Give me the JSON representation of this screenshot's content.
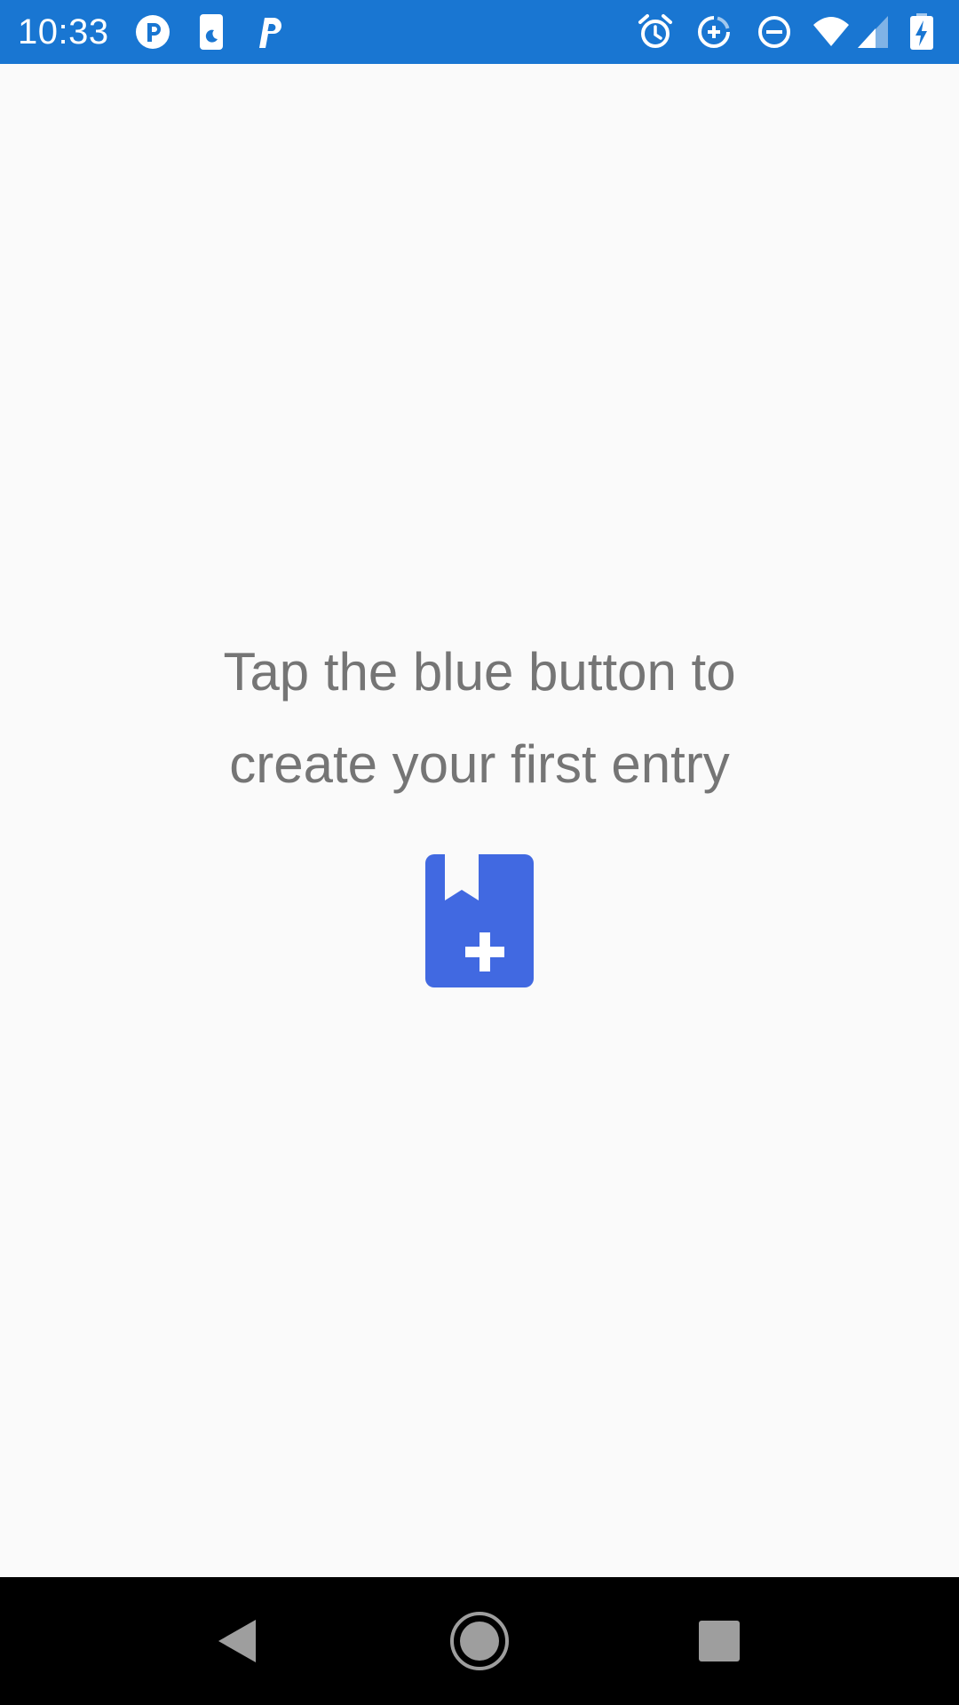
{
  "status_bar": {
    "time": "10:33",
    "background_color": "#1976d2",
    "left_icons": [
      "parking-icon",
      "night-mode-icon",
      "parking-p-icon"
    ],
    "right_icons": [
      "alarm-icon",
      "data-saver-icon",
      "do-not-disturb-icon",
      "wifi-icon",
      "cell-signal-icon",
      "battery-charging-icon"
    ]
  },
  "main": {
    "empty_message_line1": "Tap the blue button to",
    "empty_message_line2": "create your first entry",
    "text_color": "#757575",
    "icon": "bookmark-add-icon",
    "icon_color": "#4169e1"
  },
  "nav_bar": {
    "buttons": [
      "back-icon",
      "home-icon",
      "recents-icon"
    ]
  }
}
